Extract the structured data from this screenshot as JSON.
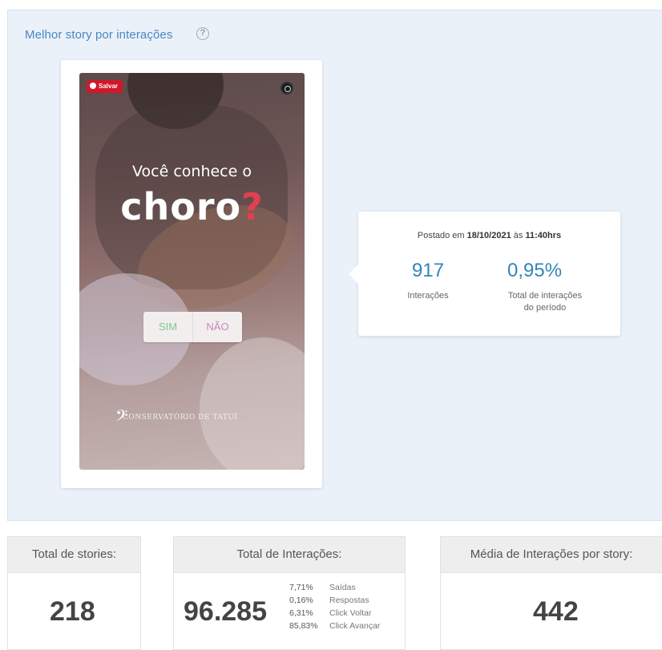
{
  "panel": {
    "title": "Melhor story por interações",
    "help_icon": "question-circle-icon"
  },
  "story": {
    "save_label": "Salvar",
    "question": "Você conhece o",
    "headline": "choro",
    "headline_mark": "?",
    "poll_yes": "SIM",
    "poll_no": "NÃO",
    "footer": "CONSERVATÓRIO DE TATUÍ"
  },
  "info": {
    "posted_prefix": "Postado em",
    "posted_date": "18/10/2021",
    "posted_mid": "às",
    "posted_time": "11:40hrs",
    "interactions_value": "917",
    "interactions_label": "Interações",
    "share_value": "0,95%",
    "share_label_1": "Total de interações",
    "share_label_2": "do período"
  },
  "stats": {
    "stories": {
      "header": "Total de stories:",
      "value": "218"
    },
    "interactions": {
      "header": "Total de Interações:",
      "value": "96.285",
      "breakdown": [
        {
          "pct": "7,71%",
          "label": "Saídas"
        },
        {
          "pct": "0,16%",
          "label": "Respostas"
        },
        {
          "pct": "6,31%",
          "label": "Click Voltar"
        },
        {
          "pct": "85,83%",
          "label": "Click Avançar"
        }
      ]
    },
    "average": {
      "header": "Média de Interações por story:",
      "value": "442"
    }
  },
  "colors": {
    "accent": "#3384b8",
    "title_blue": "#4a87c2",
    "panel_bg": "#eaf1f9",
    "save_red": "#d3172a"
  }
}
